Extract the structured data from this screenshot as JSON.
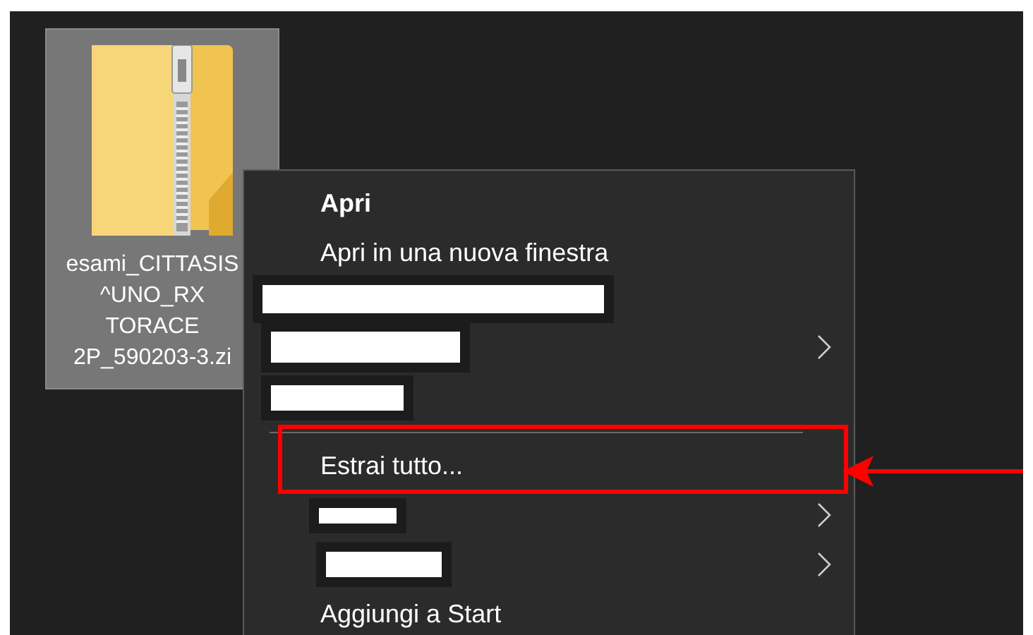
{
  "desktop_icon": {
    "label_lines": [
      "esami_CITTASIS",
      "^UNO_RX",
      "TORACE",
      "2P_590203-3.zi"
    ],
    "selected": true
  },
  "context_menu": {
    "items": [
      {
        "kind": "item",
        "label": "Apri",
        "default": true,
        "submenu": false,
        "highlighted": false
      },
      {
        "kind": "item",
        "label": "Apri in una nuova finestra",
        "default": false,
        "submenu": false,
        "highlighted": false
      },
      {
        "kind": "redacted",
        "submenu": false,
        "highlighted": false
      },
      {
        "kind": "redacted",
        "submenu": true,
        "highlighted": false
      },
      {
        "kind": "redacted",
        "submenu": false,
        "highlighted": false
      },
      {
        "kind": "separator"
      },
      {
        "kind": "item",
        "label": "Estrai tutto...",
        "default": false,
        "submenu": false,
        "highlighted": true
      },
      {
        "kind": "redacted",
        "submenu": true,
        "highlighted": false
      },
      {
        "kind": "redacted",
        "submenu": true,
        "highlighted": false
      },
      {
        "kind": "item",
        "label": "Aggiungi a Start",
        "default": false,
        "submenu": false,
        "highlighted": false
      }
    ]
  },
  "annotation_arrow": true
}
